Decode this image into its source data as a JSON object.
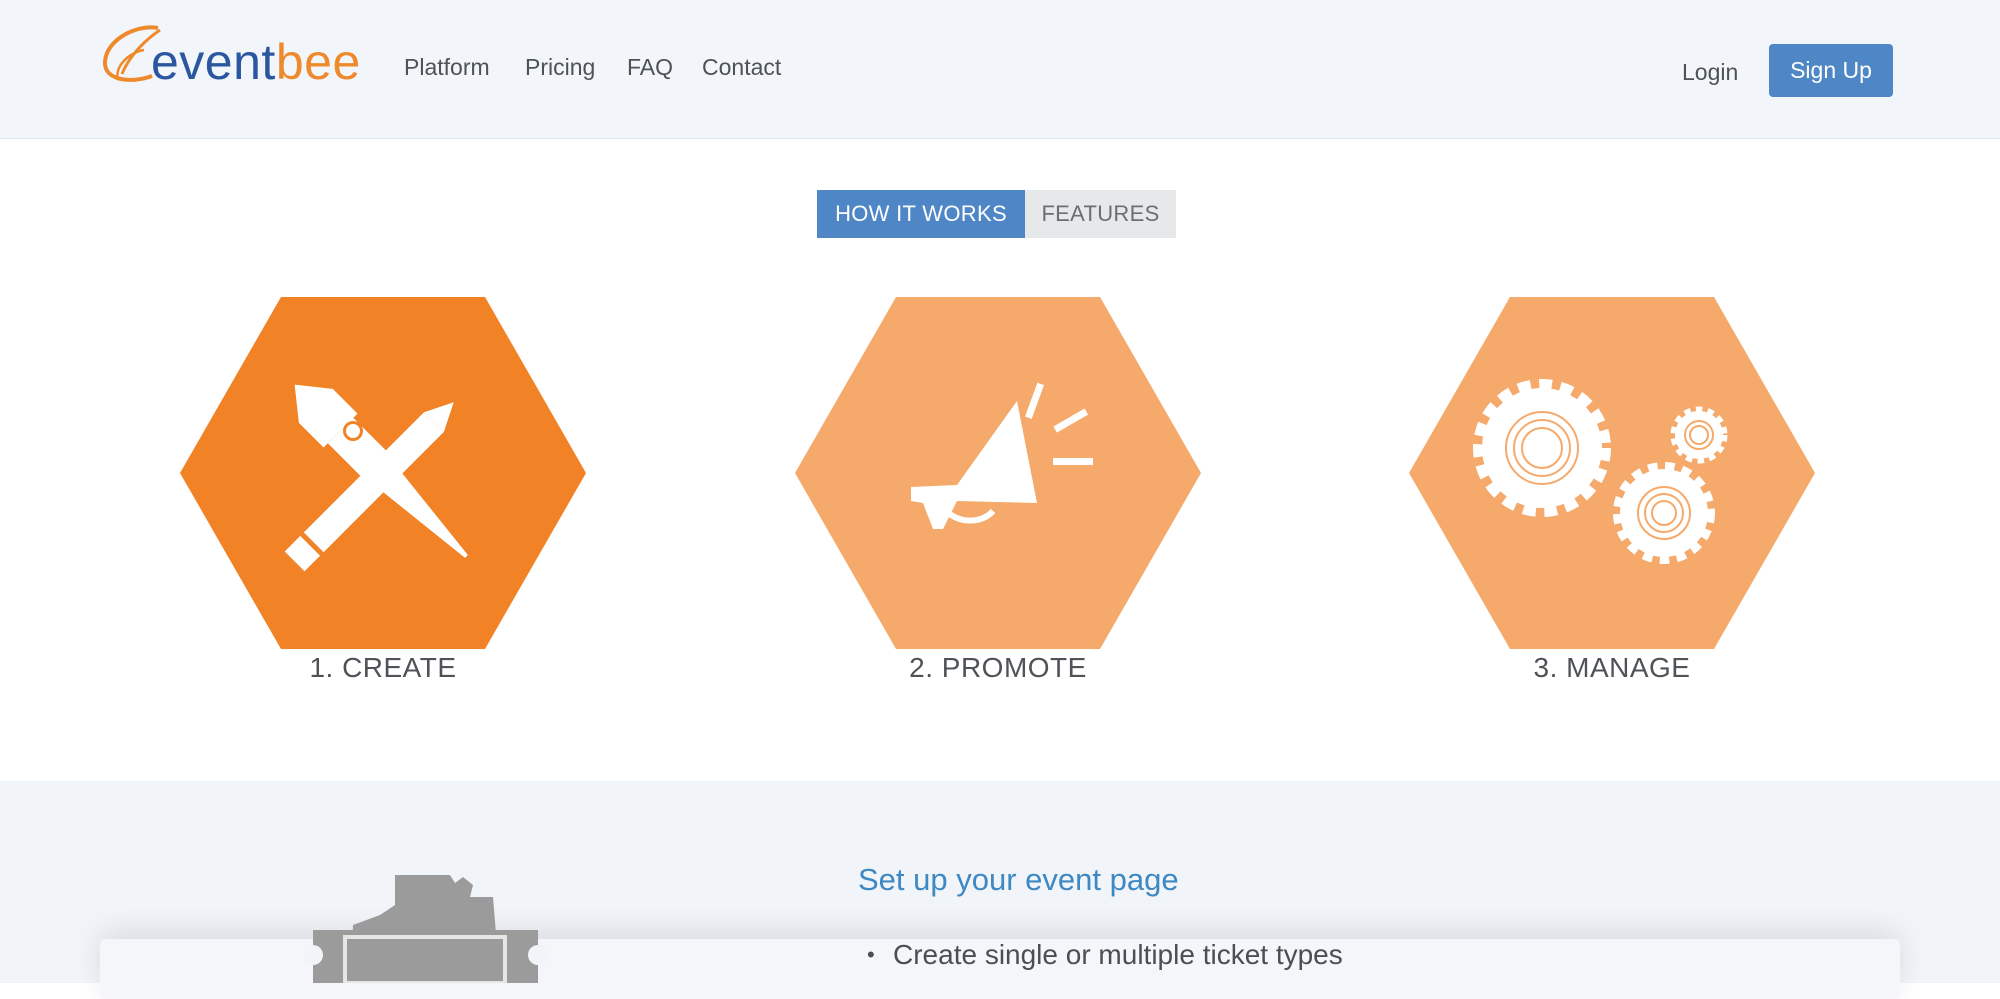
{
  "brand": {
    "logo_part1": "event",
    "logo_part2": "bee",
    "logo_colors": {
      "blue": "#2b57a0",
      "orange": "#ee8a2b"
    }
  },
  "nav": {
    "items": [
      {
        "label": "Platform"
      },
      {
        "label": "Pricing"
      },
      {
        "label": "FAQ"
      },
      {
        "label": "Contact"
      }
    ],
    "login_label": "Login",
    "signup_label": "Sign Up"
  },
  "tabs": [
    {
      "label": "HOW IT WORKS",
      "active": true
    },
    {
      "label": "FEATURES",
      "active": false
    }
  ],
  "steps": [
    {
      "label": "1. CREATE",
      "icon": "pen-pencil-cross-icon",
      "active": true
    },
    {
      "label": "2. PROMOTE",
      "icon": "megaphone-icon",
      "active": false
    },
    {
      "label": "3. MANAGE",
      "icon": "gears-icon",
      "active": false
    }
  ],
  "feature": {
    "title": "Set up your event page",
    "bullets": [
      "Create single or multiple ticket types"
    ],
    "icon": "ticket-icon"
  },
  "colors": {
    "accent_blue": "#4f86c6",
    "hex_active": "#f18226",
    "hex_inactive": "#f5a96b",
    "title_blue": "#3e88c4"
  }
}
